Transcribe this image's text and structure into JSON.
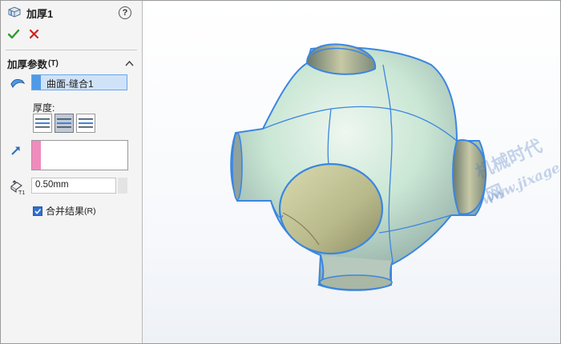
{
  "panel": {
    "title": "加厚1",
    "help_label": "?",
    "section": {
      "title": "加厚参数",
      "shortcut": "(T)"
    },
    "face_selection": "曲面-缝合1",
    "thickness_label": "厚度:",
    "thickness_value": "0.50mm",
    "merge": {
      "label": "合并结果",
      "shortcut": "(R)",
      "checked": true
    }
  },
  "icons": [
    "thicken-feature-icon",
    "help-icon",
    "confirm-check-icon",
    "cancel-x-icon",
    "collapse-caret-icon",
    "surface-face-icon",
    "thicken-side1-icon",
    "thicken-both-icon",
    "thicken-side2-icon",
    "direction-arrow-icon",
    "thickness-t1-icon"
  ],
  "watermark": {
    "line1": "机械时代网",
    "line2": "www.jixage.com"
  },
  "colors": {
    "selection_blue": "#4f9ae8",
    "selection_pink": "#f08bbd",
    "ok_green": "#2d9a2d",
    "cancel_red": "#d42020",
    "edge_blue": "#3a86e0"
  }
}
